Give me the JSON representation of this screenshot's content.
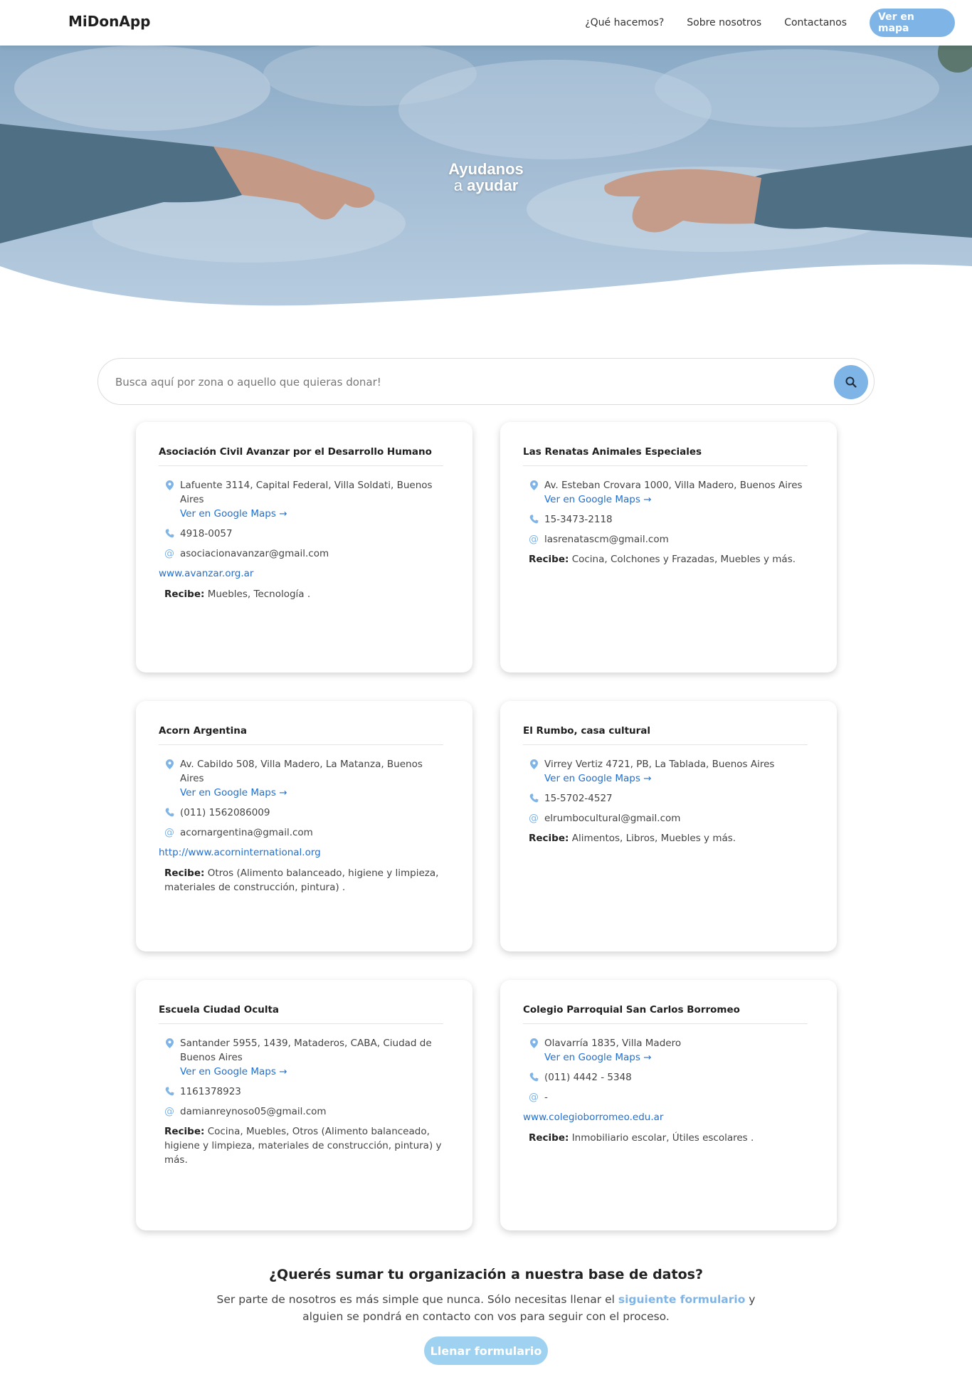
{
  "navbar": {
    "brand": "MiDonApp",
    "links": [
      "¿Qué hacemos?",
      "Sobre nosotros",
      "Contactanos"
    ],
    "cta_label": "Ver en mapa"
  },
  "hero": {
    "line1": "Ayudanos",
    "line2_prefix": "a",
    "line2_bold": "ayudar"
  },
  "search": {
    "placeholder": "Busca aquí por zona o aquello que quieras donar!"
  },
  "labels": {
    "maps_link": "Ver en Google Maps →",
    "recibe": "Recibe:"
  },
  "organizations": [
    {
      "name": "Asociación Civil Avanzar por el Desarrollo Humano",
      "address": "Lafuente 3114, Capital Federal, Villa Soldati, Buenos Aires",
      "phone": "4918-0057",
      "email": "asociacionavanzar@gmail.com",
      "website": "www.avanzar.org.ar",
      "receives": "Muebles, Tecnología ."
    },
    {
      "name": "Las Renatas Animales Especiales",
      "address": "Av. Esteban Crovara 1000, Villa Madero, Buenos Aires",
      "phone": "15-3473-2118",
      "email": "lasrenatascm@gmail.com",
      "website": "",
      "receives": "Cocina, Colchones y Frazadas, Muebles y más."
    },
    {
      "name": "Acorn Argentina",
      "address": "Av. Cabildo 508, Villa Madero, La Matanza, Buenos Aires",
      "phone": "(011) 1562086009",
      "email": "acornargentina@gmail.com",
      "website": "http://www.acorninternational.org",
      "receives": "Otros (Alimento balanceado, higiene y limpieza, materiales de construcción, pintura) ."
    },
    {
      "name": "El Rumbo, casa cultural",
      "address": "Virrey Vertiz 4721, PB, La Tablada, Buenos Aires",
      "phone": "15-5702-4527",
      "email": "elrumbocultural@gmail.com",
      "website": "",
      "receives": "Alimentos, Libros, Muebles y más."
    },
    {
      "name": "Escuela Ciudad Oculta",
      "address": "Santander 5955, 1439, Mataderos, CABA, Ciudad de Buenos Aires",
      "phone": "1161378923",
      "email": "damianreynoso05@gmail.com",
      "website": "",
      "receives": "Cocina, Muebles, Otros (Alimento balanceado, higiene y limpieza, materiales de construcción, pintura) y más."
    },
    {
      "name": "Colegio Parroquial San Carlos Borromeo",
      "address": "Olavarría 1835, Villa Madero",
      "phone": "(011) 4442 - 5348",
      "email": "-",
      "website": "www.colegioborromeo.edu.ar",
      "receives": "Inmobiliario escolar, Útiles escolares ."
    }
  ],
  "cta": {
    "title": "¿Querés sumar tu organización a nuestra base de datos?",
    "text_before": "Ser parte de nosotros es más simple que nunca. Sólo necesitas llenar el",
    "link_text": "siguiente formulario",
    "text_after": "y alguien se pondrá en contacto con vos para seguir con el proceso.",
    "button_label": "Llenar formulario"
  },
  "colors": {
    "accent": "#7fb4e6",
    "link": "#1f6fd1",
    "cta_button": "#9fd1f0"
  }
}
